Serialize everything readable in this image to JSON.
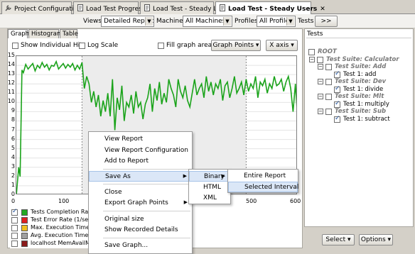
{
  "tabs": [
    {
      "label": "Project Configuration",
      "icon": "wrench-icon"
    },
    {
      "label": "Load Test Progress",
      "icon": "document-icon"
    },
    {
      "label": "Load Test - Steady Load",
      "icon": "document-icon"
    },
    {
      "label": "Load Test - Steady Users",
      "icon": "document-icon",
      "close": "✕"
    }
  ],
  "toolbar": {
    "views_label": "Views",
    "views_value": "Detailed Report",
    "machines_label": "Machines",
    "machines_value": "All Machines",
    "profiles_label": "Profiles",
    "profiles_value": "All Profiles",
    "tests_label": "Tests",
    "tests_button": ">>"
  },
  "subtabs": [
    "Graph",
    "Histogram",
    "Table"
  ],
  "graph_options": {
    "show_individual_hits": "Show Individual Hits",
    "log_scale": "Log Scale",
    "fill_graph_areas": "Fill graph areas",
    "graph_points": "Graph Points",
    "x_axis": "X axis"
  },
  "chart_data": {
    "type": "line",
    "ylim": [
      0,
      15
    ],
    "xlim": [
      0,
      600
    ],
    "yticks": [
      "0",
      "1",
      "2",
      "3",
      "4",
      "5",
      "6",
      "7",
      "8",
      "9",
      "10",
      "11",
      "12",
      "13",
      "14",
      "15"
    ],
    "xticks": [
      "0",
      "100",
      "500",
      "600"
    ],
    "series": [
      {
        "name": "Tests Completion Rate",
        "color": "#1aa31a",
        "x": [
          0,
          5,
          8,
          12,
          15,
          20,
          25,
          30,
          35,
          40,
          45,
          50,
          55,
          60,
          65,
          70,
          75,
          80,
          85,
          90,
          95,
          100,
          105,
          110,
          115,
          120,
          125,
          130,
          135,
          140,
          145,
          150,
          155,
          160,
          165,
          170,
          175,
          180,
          185,
          190,
          195,
          200,
          205,
          210,
          215,
          220,
          225,
          230,
          235,
          240,
          245,
          250,
          255,
          260,
          265,
          270,
          275,
          280,
          285,
          290,
          295,
          300,
          305,
          310,
          315,
          320,
          325,
          330,
          335,
          340,
          345,
          350,
          355,
          360,
          365,
          370,
          375,
          380,
          385,
          390,
          395,
          400,
          405,
          410,
          415,
          420,
          425,
          430,
          435,
          440,
          445,
          450,
          455,
          460,
          465,
          470,
          475,
          480,
          485,
          490,
          495,
          500,
          505,
          510,
          515,
          520,
          525,
          530,
          535,
          540,
          545,
          550,
          555,
          560,
          565,
          570,
          575,
          580,
          585,
          590,
          595,
          600
        ],
        "values": [
          0,
          3,
          2,
          13.5,
          13.2,
          14.1,
          13.6,
          13.9,
          14.2,
          13.4,
          14.0,
          13.7,
          14.3,
          13.8,
          14.1,
          13.5,
          14.0,
          13.9,
          14.4,
          13.6,
          13.9,
          14.2,
          13.7,
          14.1,
          13.8,
          14.2,
          13.5,
          14.0,
          13.6,
          14.3,
          11.5,
          12.8,
          12.0,
          10.0,
          11.2,
          9.5,
          10.8,
          8.5,
          10.2,
          9.0,
          11.0,
          8.5,
          12.5,
          7.0,
          10.5,
          9.2,
          11.8,
          8.0,
          10.0,
          9.5,
          10.8,
          8.8,
          11.2,
          9.5,
          10.0,
          8.2,
          9.8,
          10.5,
          12.0,
          9.0,
          11.5,
          10.2,
          12.2,
          9.8,
          11.0,
          10.0,
          12.5,
          11.5,
          10.8,
          9.5,
          12.5,
          11.2,
          10.5,
          11.8,
          10.2,
          9.5,
          11.0,
          12.5,
          10.8,
          11.5,
          12.0,
          10.5,
          12.8,
          11.2,
          12.2,
          10.8,
          12.0,
          11.5,
          12.5,
          10.2,
          11.8,
          12.2,
          10.5,
          11.5,
          12.8,
          11.0,
          11.5,
          12.2,
          10.8,
          12.5,
          11.2,
          12.0,
          11.5,
          12.8,
          10.5,
          12.2,
          11.8,
          12.5,
          11.0,
          12.0,
          11.5,
          12.8,
          11.8,
          12.0,
          12.5,
          11.2,
          12.2,
          12.8,
          11.5,
          9.0,
          12.0,
          8.0
        ]
      }
    ]
  },
  "legend": [
    {
      "label": "Tests Completion Rate",
      "color": "#22aa22",
      "checked": true
    },
    {
      "label": "Test Error Rate (1/sec)",
      "color": "#e02020",
      "checked": false
    },
    {
      "label": "Max. Execution Time (m",
      "color": "#f0c020",
      "checked": false
    },
    {
      "label": "Avg. Execution Time (m",
      "color": "#a0a0a0",
      "checked": false
    },
    {
      "label": "localhost MemAvailMB",
      "color": "#8b1a1a",
      "checked": false
    }
  ],
  "tree": {
    "header": "Tests",
    "nodes": [
      {
        "label": "ROOT",
        "kind": "suite",
        "level": 0,
        "checked": false
      },
      {
        "label": "Test Suite: Calculator",
        "kind": "suite",
        "level": 1,
        "checked": false
      },
      {
        "label": "Test Suite: Add",
        "kind": "suite",
        "level": 2,
        "checked": false
      },
      {
        "label": "Test 1: add",
        "kind": "test",
        "level": 3,
        "checked": true
      },
      {
        "label": "Test Suite: Dev",
        "kind": "suite",
        "level": 2,
        "checked": false
      },
      {
        "label": "Test 1: divide",
        "kind": "test",
        "level": 3,
        "checked": true
      },
      {
        "label": "Test Suite: Mlt",
        "kind": "suite",
        "level": 2,
        "checked": false
      },
      {
        "label": "Test 1: multiply",
        "kind": "test",
        "level": 3,
        "checked": true
      },
      {
        "label": "Test Suite: Sub",
        "kind": "suite",
        "level": 2,
        "checked": false
      },
      {
        "label": "Test 1: subtract",
        "kind": "test",
        "level": 3,
        "checked": true
      }
    ],
    "select_button": "Select",
    "options_button": "Options"
  },
  "context_menu": {
    "items": [
      "View Report",
      "View Report Configuration",
      "Add to Report",
      "Save As",
      "Close",
      "Export Graph Points",
      "Original size",
      "Show Recorded Details",
      "Save Graph..."
    ],
    "partial_label": ")"
  },
  "saveas_menu": {
    "items": [
      "Binary",
      "HTML",
      "XML"
    ]
  },
  "binary_menu": {
    "items": [
      "Entire Report",
      "Selected Interval"
    ]
  }
}
